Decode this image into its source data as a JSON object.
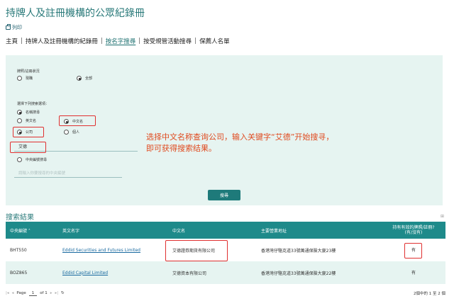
{
  "page": {
    "title": "持牌人及註冊機構的公眾紀錄冊",
    "print_label": "列印"
  },
  "nav": {
    "items": [
      "主頁",
      "持牌人及註冊機構的紀錄冊",
      "按名字搜尋",
      "按受規管活動搜尋",
      "保薦人名單"
    ]
  },
  "form": {
    "status_label": "牌照/註冊狀況",
    "status_current": "現職",
    "status_all": "全部",
    "choose_label": "選擇下列搜索選項：",
    "opt_name": "名稱搜尋",
    "opt_english": "英文名",
    "opt_chinese": "中文名",
    "opt_company": "公司",
    "opt_individual": "個人",
    "keyword_value": "艾德",
    "opt_ceref": "中央編號搜尋",
    "ceref_placeholder": "請輸入你要搜尋的中央編號",
    "search_button": "搜尋"
  },
  "annotation": {
    "line1": "选择中文名称查询公司，输入关键字“艾德”开始搜寻，",
    "line2": "即可获得搜索结果。"
  },
  "results": {
    "title": "搜索結果",
    "headers": [
      "中央編號 ˄",
      "英文名字",
      "中文名",
      "主要營業地址",
      "持有有效的牌照/註冊?",
      "(有/沒有)"
    ],
    "rows": [
      {
        "ce": "BHT550",
        "en": "Eddid Securities and Futures Limited",
        "zh": "艾德證券期貨有限公司",
        "addr": "香港灣仔駱克道33號萬通保險大廈23樓",
        "valid": "有"
      },
      {
        "ce": "BOZ865",
        "en": "Eddid Capital Limited",
        "zh": "艾德資本有限公司",
        "addr": "香港灣仔駱克道33號萬通保險大廈22樓",
        "valid": "有"
      }
    ]
  },
  "pager": {
    "page_label": "Page",
    "page_num": "1",
    "of_label": "of 1",
    "count_text": "2個中的 1 至 2 個"
  },
  "colors": {
    "accent": "#1e8a8a",
    "panel": "#e6f4f1",
    "highlight": "#e03030",
    "annotation": "#e04a1f"
  }
}
